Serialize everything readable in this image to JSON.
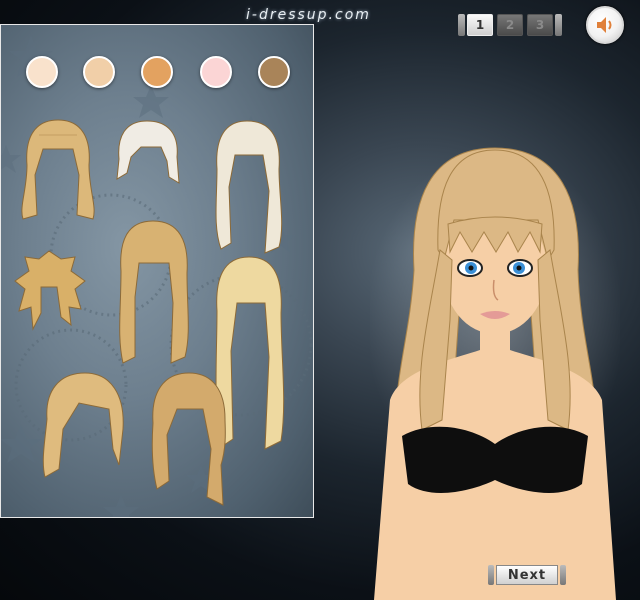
{
  "brand": {
    "text": "i-dressup.com"
  },
  "pager": {
    "pages": [
      "1",
      "2",
      "3"
    ],
    "active": "1"
  },
  "sound": {
    "icon": "speaker-icon"
  },
  "skin_tones": [
    "#f9e2cc",
    "#f1cfa8",
    "#e3a260",
    "#fbd5d5",
    "#a98459"
  ],
  "hairstyles": [
    {
      "name": "blonde-bangs-medium",
      "color": "#dcb87a"
    },
    {
      "name": "platinum-short-choppy",
      "color": "#f0ece4"
    },
    {
      "name": "platinum-long-wavy",
      "color": "#efe8d8"
    },
    {
      "name": "honey-short-messy",
      "color": "#d9b068"
    },
    {
      "name": "honey-long-straight",
      "color": "#d8b272"
    },
    {
      "name": "pale-blonde-long-waves",
      "color": "#eed9a0"
    },
    {
      "name": "golden-side-bob",
      "color": "#dfbb7e"
    },
    {
      "name": "golden-bob",
      "color": "#d3aa6c"
    }
  ],
  "model": {
    "hair_color": "#dcb885",
    "skin_color": "#f6cfa6",
    "top_color": "#0e0e0e",
    "eye_color": "#3a8fd6"
  },
  "next_button": {
    "label": "Next"
  }
}
